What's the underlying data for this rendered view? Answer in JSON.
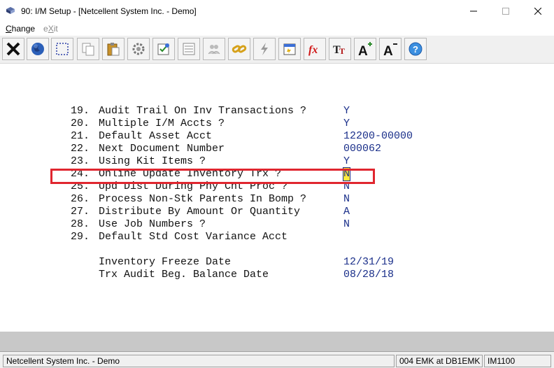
{
  "window": {
    "title": "90: I/M Setup - [Netcellent System Inc. - Demo]",
    "icon": "dbase-app-icon"
  },
  "menu": {
    "change": {
      "mnemonic": "C",
      "rest": "hange"
    },
    "exit": {
      "pre": "e",
      "mnemonic": "X",
      "rest": "it"
    }
  },
  "toolbar": {
    "buttons": [
      "close",
      "globe",
      "select",
      "copy",
      "paste",
      "settings",
      "check-form",
      "list",
      "users",
      "link",
      "lightning",
      "calendar",
      "function",
      "font",
      "increase-font",
      "decrease-font",
      "help"
    ]
  },
  "fields": [
    {
      "num": "19.",
      "label": "Audit Trail On Inv Transactions ?",
      "value": "Y"
    },
    {
      "num": "20.",
      "label": "Multiple I/M Accts ?",
      "value": "Y"
    },
    {
      "num": "21.",
      "label": "Default Asset Acct",
      "value": "12200-00000"
    },
    {
      "num": "22.",
      "label": "Next Document Number",
      "value": "000062"
    },
    {
      "num": "23.",
      "label": "Using Kit Items ?",
      "value": "Y"
    },
    {
      "num": "24.",
      "label": "Online Update Inventory Trx ?",
      "value": "N"
    },
    {
      "num": "25.",
      "label": "Upd Dist During Phy Cnt Proc ?",
      "value": "N"
    },
    {
      "num": "26.",
      "label": "Process Non-Stk Parents In Bomp ?",
      "value": "N"
    },
    {
      "num": "27.",
      "label": "Distribute By Amount Or Quantity",
      "value": "A"
    },
    {
      "num": "28.",
      "label": "Use Job Numbers ?",
      "value": "N"
    },
    {
      "num": "29.",
      "label": "Default Std Cost Variance Acct",
      "value": ""
    }
  ],
  "extra": [
    {
      "label": "Inventory Freeze Date",
      "value": "12/31/19"
    },
    {
      "label": "Trx Audit Beg. Balance Date",
      "value": "08/28/18"
    }
  ],
  "status": {
    "company": "Netcellent System Inc. - Demo",
    "user": "004 EMK at DB1EMK",
    "module": "IM1100"
  },
  "colors": {
    "highlight": "#e0262f",
    "value_text": "#1a2f8a",
    "cursor": "#ffeb3b"
  }
}
